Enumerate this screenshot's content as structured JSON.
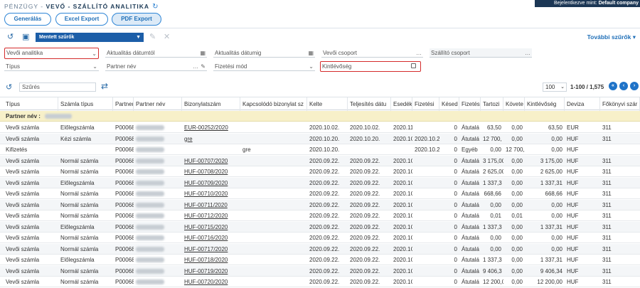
{
  "header": {
    "breadcrumb_prefix": "PÉNZÜGY - ",
    "title": "VEVŐ - SZÁLLÍTÓ ANALITIKA",
    "user_prefix": "Bejelentkezve mint: ",
    "user_name": "Default company"
  },
  "tabs": [
    {
      "label": "Generálás"
    },
    {
      "label": "Excel Export"
    },
    {
      "label": "PDF Export"
    }
  ],
  "toolbar": {
    "saved_filters": "Mentett szűrők",
    "more_filters": "További szűrők"
  },
  "filters": {
    "analytics": "Vevői analitika",
    "update_from": "Aktualitás dátumtól",
    "update_to": "Aktualitás dátumig",
    "customer_group": "Vevői csoport",
    "supplier_group": "Szállító csoport",
    "type": "Típus",
    "partner_name": "Partner név",
    "payment_method": "Fizetési mód",
    "receivable": "Kintlévőség"
  },
  "grid_toolbar": {
    "search_placeholder": "Szűrés",
    "page_size": "100",
    "range": "1-100 / 1,575"
  },
  "columns": [
    "Típus",
    "Számla típus",
    "Partner",
    "Partner név",
    "Bizonylatszám",
    "Kapcsolódó bizonylat sz",
    "Kelte",
    "Teljesítés dátu",
    "Esedék",
    "Fizetési",
    "Késed",
    "Fizetés",
    "Tartozi",
    "Követe",
    "Kintlévőség",
    "Deviza",
    "Főkönyvi szár"
  ],
  "group": {
    "label": "Partner név :"
  },
  "rows": [
    {
      "type": "Vevői számla",
      "inv": "Előlegszámla",
      "pid": "P00068",
      "doc": "EUR-00252/2020",
      "rel": "",
      "date": "2020.10.02.",
      "perf": "2020.10.02.",
      "due": "2020.11",
      "pay": "",
      "late": "0",
      "method": "Átutalá",
      "debit": "63,50",
      "credit": "0,00",
      "out": "63,50",
      "cur": "EUR",
      "gl": "311"
    },
    {
      "type": "Vevői számla",
      "inv": "Kézi számla",
      "pid": "P00068",
      "doc": "gre",
      "rel": "",
      "date": "2020.10.20.",
      "perf": "2020.10.20.",
      "due": "2020.1C",
      "pay": "2020.10.2",
      "late": "0",
      "method": "Átutalá",
      "debit": "12 700,",
      "credit": "0,00",
      "out": "0,00",
      "cur": "HUF",
      "gl": "311"
    },
    {
      "type": "Kifizetés",
      "inv": "",
      "pid": "P00068",
      "doc": "",
      "rel": "gre",
      "date": "2020.10.20.",
      "perf": "",
      "due": "",
      "pay": "2020.10.2",
      "late": "0",
      "method": "Egyéb",
      "debit": "0,00",
      "credit": "12 700,",
      "out": "0,00",
      "cur": "HUF",
      "gl": ""
    },
    {
      "type": "Vevői számla",
      "inv": "Normál számla",
      "pid": "P00068",
      "doc": "HUF-00707/2020",
      "rel": "",
      "date": "2020.09.22.",
      "perf": "2020.09.22.",
      "due": "2020.1C",
      "pay": "",
      "late": "0",
      "method": "Átutalá",
      "debit": "3 175,00",
      "credit": "0,00",
      "out": "3 175,00",
      "cur": "HUF",
      "gl": "311"
    },
    {
      "type": "Vevői számla",
      "inv": "Normál számla",
      "pid": "P00068",
      "doc": "HUF-00708/2020",
      "rel": "",
      "date": "2020.09.22.",
      "perf": "2020.09.22.",
      "due": "2020.1C",
      "pay": "",
      "late": "0",
      "method": "Átutalá",
      "debit": "2 625,00",
      "credit": "0,00",
      "out": "2 625,00",
      "cur": "HUF",
      "gl": "311"
    },
    {
      "type": "Vevői számla",
      "inv": "Előlegszámla",
      "pid": "P00068",
      "doc": "HUF-00709/2020",
      "rel": "",
      "date": "2020.09.22.",
      "perf": "2020.09.22.",
      "due": "2020.1C",
      "pay": "",
      "late": "0",
      "method": "Átutalá",
      "debit": "1 337,3",
      "credit": "0,00",
      "out": "1 337,31",
      "cur": "HUF",
      "gl": "311"
    },
    {
      "type": "Vevői számla",
      "inv": "Normál számla",
      "pid": "P00068",
      "doc": "HUF-00710/2020",
      "rel": "",
      "date": "2020.09.22.",
      "perf": "2020.09.22.",
      "due": "2020.1C",
      "pay": "",
      "late": "0",
      "method": "Átutalá",
      "debit": "668,66",
      "credit": "0,00",
      "out": "668,66",
      "cur": "HUF",
      "gl": "311"
    },
    {
      "type": "Vevői számla",
      "inv": "Normál számla",
      "pid": "P00068",
      "doc": "HUF-00711/2020",
      "rel": "",
      "date": "2020.09.22.",
      "perf": "2020.09.22.",
      "due": "2020.1C",
      "pay": "",
      "late": "0",
      "method": "Átutalá",
      "debit": "0,00",
      "credit": "0,00",
      "out": "0,00",
      "cur": "HUF",
      "gl": "311"
    },
    {
      "type": "Vevői számla",
      "inv": "Normál számla",
      "pid": "P00068",
      "doc": "HUF-00712/2020",
      "rel": "",
      "date": "2020.09.22.",
      "perf": "2020.09.22.",
      "due": "2020.1C",
      "pay": "",
      "late": "0",
      "method": "Átutalá",
      "debit": "0,01",
      "credit": "0,01",
      "out": "0,00",
      "cur": "HUF",
      "gl": "311"
    },
    {
      "type": "Vevői számla",
      "inv": "Előlegszámla",
      "pid": "P00068",
      "doc": "HUF-00715/2020",
      "rel": "",
      "date": "2020.09.22.",
      "perf": "2020.09.22.",
      "due": "2020.1C",
      "pay": "",
      "late": "0",
      "method": "Átutalá",
      "debit": "1 337,3",
      "credit": "0,00",
      "out": "1 337,31",
      "cur": "HUF",
      "gl": "311"
    },
    {
      "type": "Vevői számla",
      "inv": "Normál számla",
      "pid": "P00068",
      "doc": "HUF-00716/2020",
      "rel": "",
      "date": "2020.09.22.",
      "perf": "2020.09.22.",
      "due": "2020.1C",
      "pay": "",
      "late": "0",
      "method": "Átutalá",
      "debit": "0,00",
      "credit": "0,00",
      "out": "0,00",
      "cur": "HUF",
      "gl": "311"
    },
    {
      "type": "Vevői számla",
      "inv": "Normál számla",
      "pid": "P00068",
      "doc": "HUF-00717/2020",
      "rel": "",
      "date": "2020.09.22.",
      "perf": "2020.09.22.",
      "due": "2020.1C",
      "pay": "",
      "late": "0",
      "method": "Átutalá",
      "debit": "0,00",
      "credit": "0,00",
      "out": "0,00",
      "cur": "HUF",
      "gl": "311"
    },
    {
      "type": "Vevői számla",
      "inv": "Előlegszámla",
      "pid": "P00068",
      "doc": "HUF-00718/2020",
      "rel": "",
      "date": "2020.09.22.",
      "perf": "2020.09.22.",
      "due": "2020.1C",
      "pay": "",
      "late": "0",
      "method": "Átutalá",
      "debit": "1 337,3",
      "credit": "0,00",
      "out": "1 337,31",
      "cur": "HUF",
      "gl": "311"
    },
    {
      "type": "Vevői számla",
      "inv": "Normál számla",
      "pid": "P00068",
      "doc": "HUF-00719/2020",
      "rel": "",
      "date": "2020.09.22.",
      "perf": "2020.09.22.",
      "due": "2020.1C",
      "pay": "",
      "late": "0",
      "method": "Átutalá",
      "debit": "9 406,3",
      "credit": "0,00",
      "out": "9 406,34",
      "cur": "HUF",
      "gl": "311"
    },
    {
      "type": "Vevői számla",
      "inv": "Normál számla",
      "pid": "P00068",
      "doc": "HUF-00720/2020",
      "rel": "",
      "date": "2020.09.22.",
      "perf": "2020.09.22.",
      "due": "2020.1C",
      "pay": "",
      "late": "0",
      "method": "Átutalá",
      "debit": "12 200,0",
      "credit": "0,00",
      "out": "12 200,00",
      "cur": "HUF",
      "gl": "311"
    }
  ]
}
